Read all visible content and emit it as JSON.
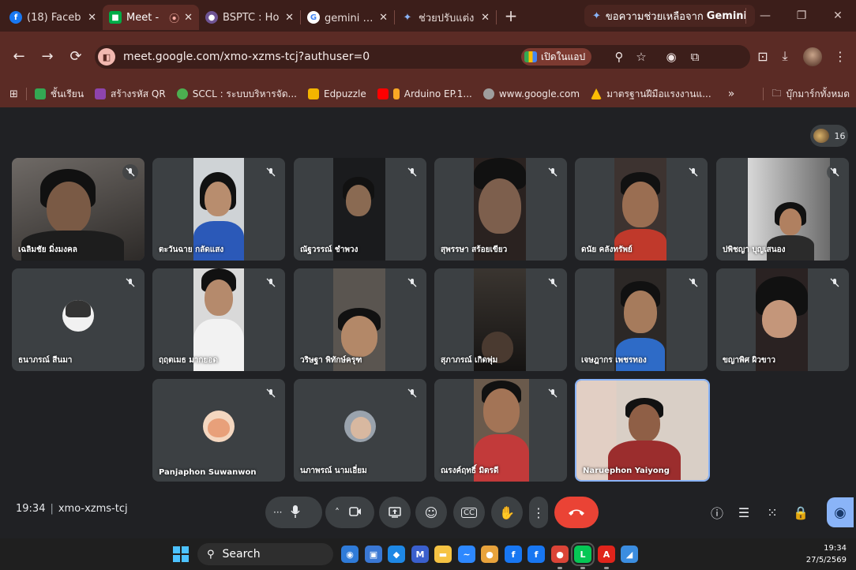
{
  "browser": {
    "tabs": [
      {
        "title": "(18) Faceb",
        "icon": "facebook-icon",
        "color": "#1877f2",
        "glyph": "f"
      },
      {
        "title": "Meet -",
        "icon": "meet-icon",
        "color": "#00ac47",
        "glyph": "■",
        "recording": "⦿"
      },
      {
        "title": "BSPTC : Ho",
        "icon": "github-icon",
        "color": "#6e5494",
        "glyph": "●"
      },
      {
        "title": "gemini - ค้",
        "icon": "google-icon",
        "color": "#ffffff",
        "glyph": "G"
      },
      {
        "title": "ช่วยปรับแต่ง",
        "icon": "gemini-sparkle-icon",
        "color": "#6d8cf0",
        "glyph": "✦"
      }
    ],
    "new_tab": "+",
    "gemini_panel_tab": {
      "title": "ขอความช่วยเหลือจาก",
      "title_bold": "Gemini"
    },
    "window_controls": {
      "minimize": "—",
      "maximize": "❐",
      "close": "✕"
    },
    "nav": {
      "back": "←",
      "forward": "→",
      "reload": "⟳"
    },
    "url": "meet.google.com/xmo-xzms-tcj?authuser=0",
    "open_in_app": "เปิดในแอป",
    "bookmarks": [
      {
        "label": "ชั้นเรียน",
        "color": "#34a853"
      },
      {
        "label": "สร้างรหัส QR",
        "color": "#8e44ad"
      },
      {
        "label": "SCCL : ระบบบริหารจัด...",
        "color": "#4caf50"
      },
      {
        "label": "Edpuzzle",
        "color": "#f4b400"
      },
      {
        "label": "Arduino EP.1...",
        "color": "#ff0000"
      },
      {
        "label": "www.google.com",
        "color": "#9e9e9e"
      },
      {
        "label": "มาตรฐานฝีมือแรงงานแ...",
        "color": "#fbbc04"
      }
    ],
    "bookmarks_more": "»",
    "all_bookmarks": "บุ๊กมาร์กทั้งหมด"
  },
  "meet": {
    "participant_count": "16",
    "participants": [
      {
        "name": "เฉลิมชัย มิ่งมงคล",
        "avatar": false
      },
      {
        "name": "ตะวันฉาย กลัดแสง",
        "avatar": false
      },
      {
        "name": "ณัฐวรรณ์ ชำพวง",
        "avatar": false
      },
      {
        "name": "สุพรรษา สร้อยเขียว",
        "avatar": false
      },
      {
        "name": "ดนัย คลังทรัพย์",
        "avatar": false
      },
      {
        "name": "ปพิชญา บุญเสนอง",
        "avatar": false
      },
      {
        "name": "ธนาภรณ์ สีนมา",
        "avatar": true
      },
      {
        "name": "ฤฤตเมธ มากยอด",
        "avatar": false
      },
      {
        "name": "วริษฐา พิทักษ์ครุฑ",
        "avatar": false
      },
      {
        "name": "สุภาภรณ์ เกิดพุ่ม",
        "avatar": false
      },
      {
        "name": "เจษฎากร เพชรทอง",
        "avatar": false
      },
      {
        "name": "ขญาพิศ ผิวขาว",
        "avatar": false
      },
      {
        "name": "Panjaphon Suwanwon",
        "avatar": true
      },
      {
        "name": "นภาพรณ์ นามเอี่ยม",
        "avatar": true
      },
      {
        "name": "ณรงค์ฤทธิ์ มิตรดี",
        "avatar": false
      },
      {
        "name": "Naruephon Yaiyong",
        "avatar": false,
        "speaking": true
      }
    ],
    "meeting_time": "19:34",
    "meeting_code": "xmo-xzms-tcj",
    "controls": {
      "more_emoji": "···",
      "mic": "🎙",
      "cam_options": "˄",
      "camera": "▣",
      "present": "⬆",
      "reactions": "☺",
      "captions": "CC",
      "raise_hand": "✋",
      "more": "⋮",
      "end": "☎"
    },
    "side": {
      "info": "ⓘ",
      "chat": "☰",
      "activities": "⁙",
      "host": "🔒",
      "ai": "◉"
    }
  },
  "taskbar": {
    "search": "Search",
    "apps": [
      {
        "name": "copilot-icon",
        "color": "#2f7bd8",
        "glyph": "◉"
      },
      {
        "name": "store-icon",
        "color": "#3a78d4",
        "glyph": "▣"
      },
      {
        "name": "photos-icon",
        "color": "#1e88e5",
        "glyph": "◆"
      },
      {
        "name": "app-m-icon",
        "color": "#3a5fcd",
        "glyph": "M"
      },
      {
        "name": "file-explorer-icon",
        "color": "#f6c343",
        "glyph": "▬"
      },
      {
        "name": "messenger-icon",
        "color": "#2d88ff",
        "glyph": "~"
      },
      {
        "name": "chrome-icon",
        "color": "#e8a33c",
        "glyph": "●"
      },
      {
        "name": "facebook-app-icon",
        "color": "#1877f2",
        "glyph": "f"
      },
      {
        "name": "facebook-app-2-icon",
        "color": "#1877f2",
        "glyph": "f"
      },
      {
        "name": "chrome-profile-icon",
        "color": "#db4437",
        "glyph": "●"
      },
      {
        "name": "line-icon",
        "color": "#06c755",
        "glyph": "L"
      },
      {
        "name": "acrobat-icon",
        "color": "#e0241b",
        "glyph": "A"
      },
      {
        "name": "paint-icon",
        "color": "#3b8de0",
        "glyph": "◢"
      }
    ],
    "time": "19:34",
    "date": "27/5/2569"
  }
}
